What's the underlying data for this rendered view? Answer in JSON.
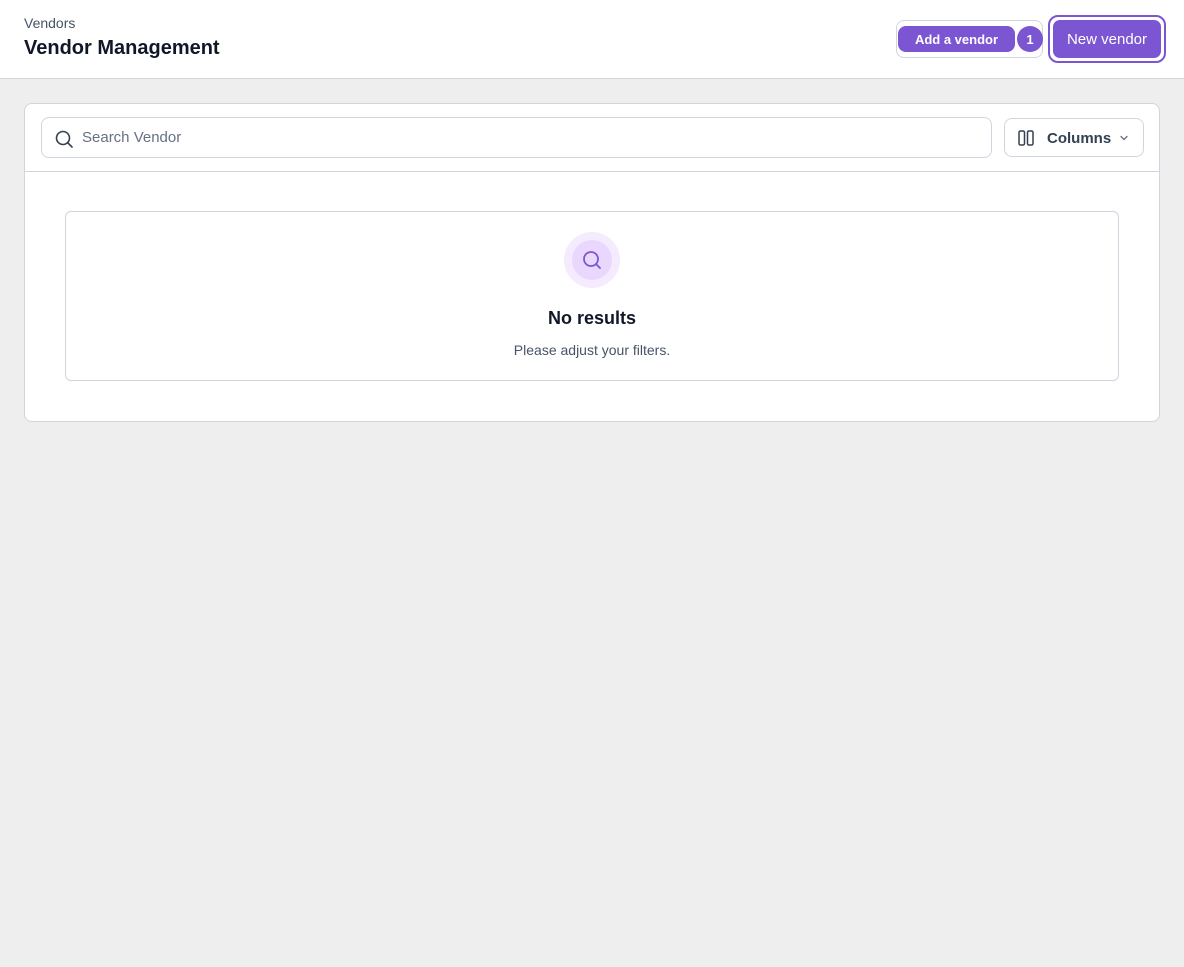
{
  "header": {
    "breadcrumb": "Vendors",
    "title": "Vendor Management",
    "guide_label": "Add a vendor",
    "guide_count": "1",
    "new_vendor_label": "New vendor"
  },
  "toolbar": {
    "search_placeholder": "Search Vendor",
    "search_value": "",
    "columns_label": "Columns"
  },
  "empty_state": {
    "title": "No results",
    "subtitle": "Please adjust your filters."
  },
  "icons": {
    "search": "search-icon",
    "columns": "columns-icon",
    "chevron": "chevron-down-icon",
    "empty": "search-icon"
  },
  "colors": {
    "accent": "#7c55d2",
    "border": "#d0d5dd",
    "background": "#eeeeee",
    "empty_icon_bg": "#f4ebff"
  }
}
